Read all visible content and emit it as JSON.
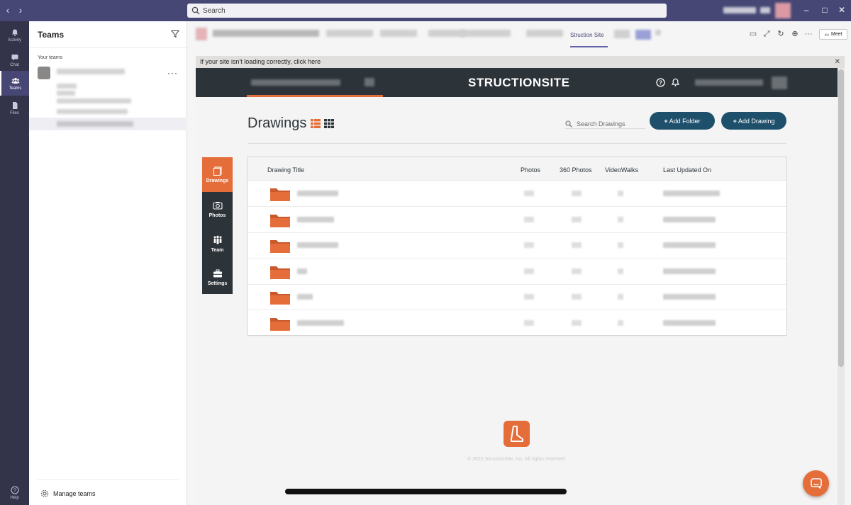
{
  "search": {
    "placeholder": "Search"
  },
  "rail": [
    {
      "label": "Activity",
      "icon": "bell-icon"
    },
    {
      "label": "Chat",
      "icon": "chat-icon"
    },
    {
      "label": "Teams",
      "icon": "teams-icon"
    },
    {
      "label": "Files",
      "icon": "file-icon"
    }
  ],
  "rail_help": {
    "label": "Help",
    "icon": "help-icon"
  },
  "teams_panel": {
    "title": "Teams",
    "section_label": "Your teams",
    "manage": "Manage teams"
  },
  "tab_bar": {
    "active_tab": "Struction Site",
    "meet": "Meet"
  },
  "notice": {
    "text": "If your site isn't loading correctly, click here"
  },
  "site": {
    "logo_text": "STRUCTIONSITE",
    "page_title": "Drawings",
    "search_placeholder": "Search Drawings",
    "add_folder": "Add Folder",
    "add_drawing": "Add Drawing",
    "side_menu": [
      {
        "label": "Drawings",
        "icon": "drawings-icon"
      },
      {
        "label": "Photos",
        "icon": "camera-icon"
      },
      {
        "label": "Team",
        "icon": "team-icon"
      },
      {
        "label": "Settings",
        "icon": "toolbox-icon"
      }
    ],
    "columns": [
      "Drawing Title",
      "Photos",
      "360 Photos",
      "VideoWalks",
      "Last Updated On"
    ],
    "row_count": 6,
    "copyright": "© 2020 StructionSite, Inc. All rights reserved."
  },
  "colors": {
    "teams_purple": "#464775",
    "rail": "#33344a",
    "structionsite_orange": "#e56d39",
    "site_nav": "#2c3339",
    "button_navy": "#1e4f6b"
  }
}
